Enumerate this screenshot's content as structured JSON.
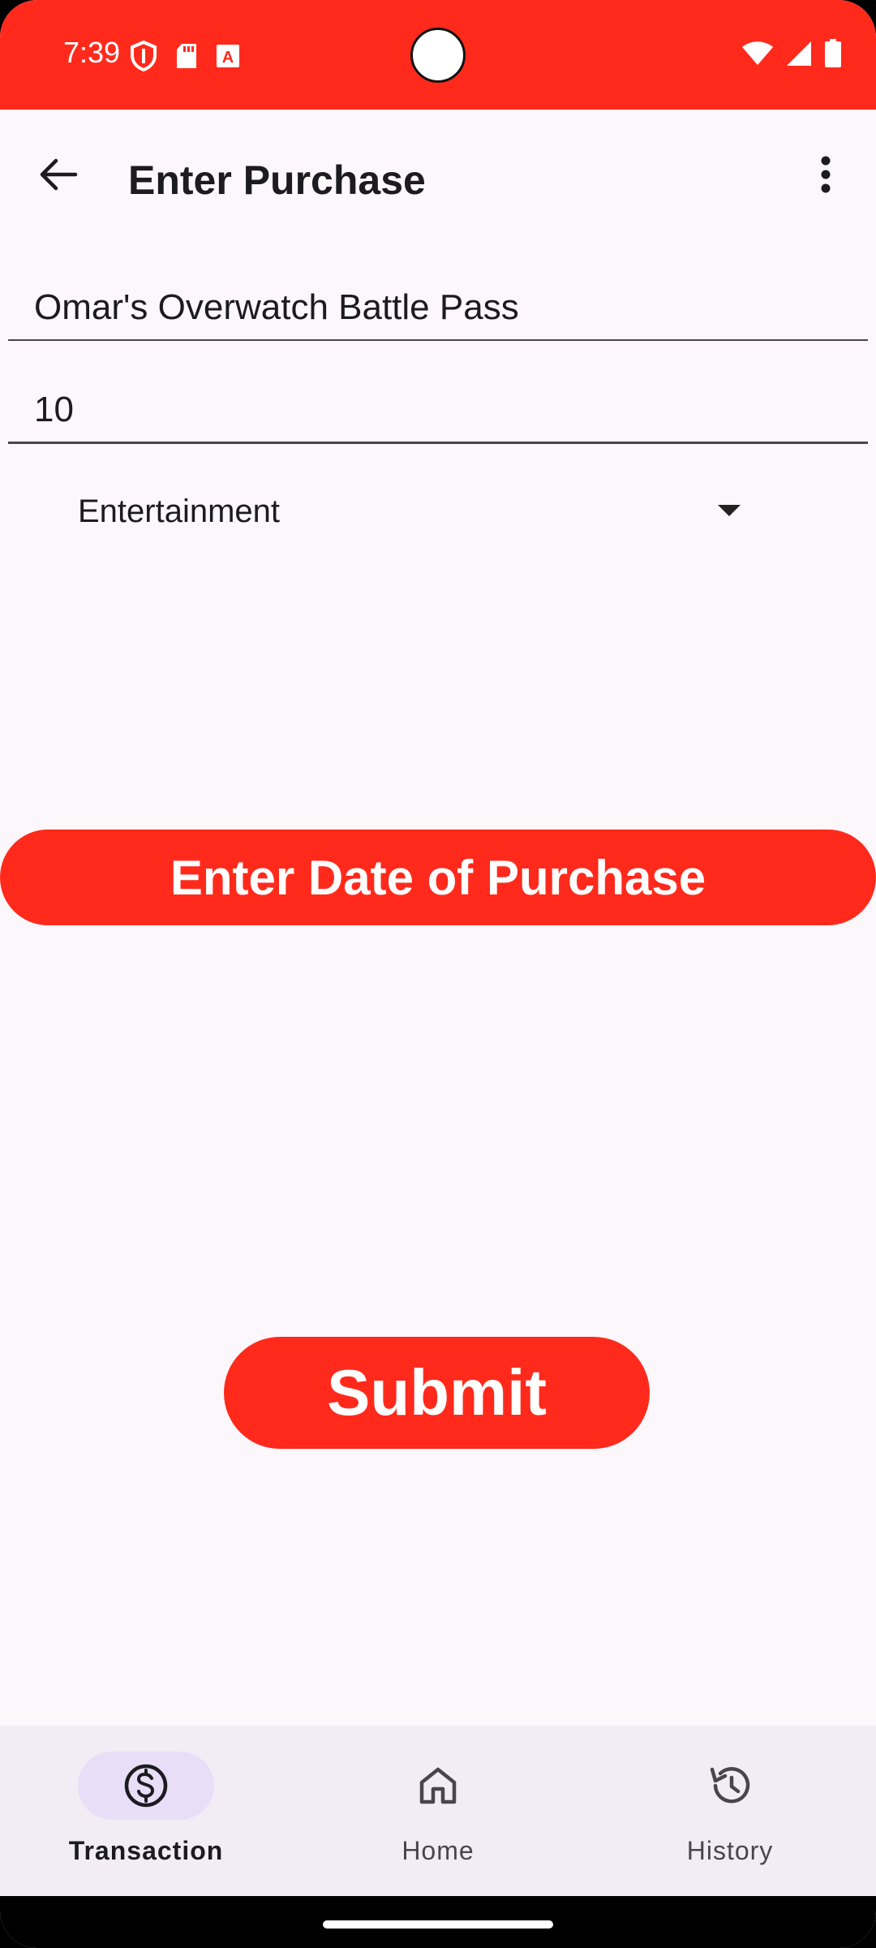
{
  "status_bar": {
    "time": "7:39",
    "icons_left": [
      "shield-icon",
      "sd-card-icon",
      "a-box-icon"
    ],
    "icons_right": [
      "wifi-icon",
      "signal-icon",
      "battery-icon"
    ],
    "color": "#FF2A1C"
  },
  "app_bar": {
    "title": "Enter Purchase"
  },
  "form": {
    "name_value": "Omar's Overwatch Battle Pass",
    "amount_value": "10",
    "category_value": "Entertainment",
    "date_button_label": "Enter Date of Purchase",
    "submit_label": "Submit"
  },
  "bottom_nav": {
    "items": [
      {
        "label": "Transaction",
        "icon": "dollar-circle-icon",
        "selected": true
      },
      {
        "label": "Home",
        "icon": "home-icon",
        "selected": false
      },
      {
        "label": "History",
        "icon": "history-icon",
        "selected": false
      }
    ]
  },
  "colors": {
    "accent": "#FF2A1C",
    "background": "#FCF7FB",
    "nav_background": "#F2ECF4",
    "nav_indicator": "#E8DEF8"
  }
}
